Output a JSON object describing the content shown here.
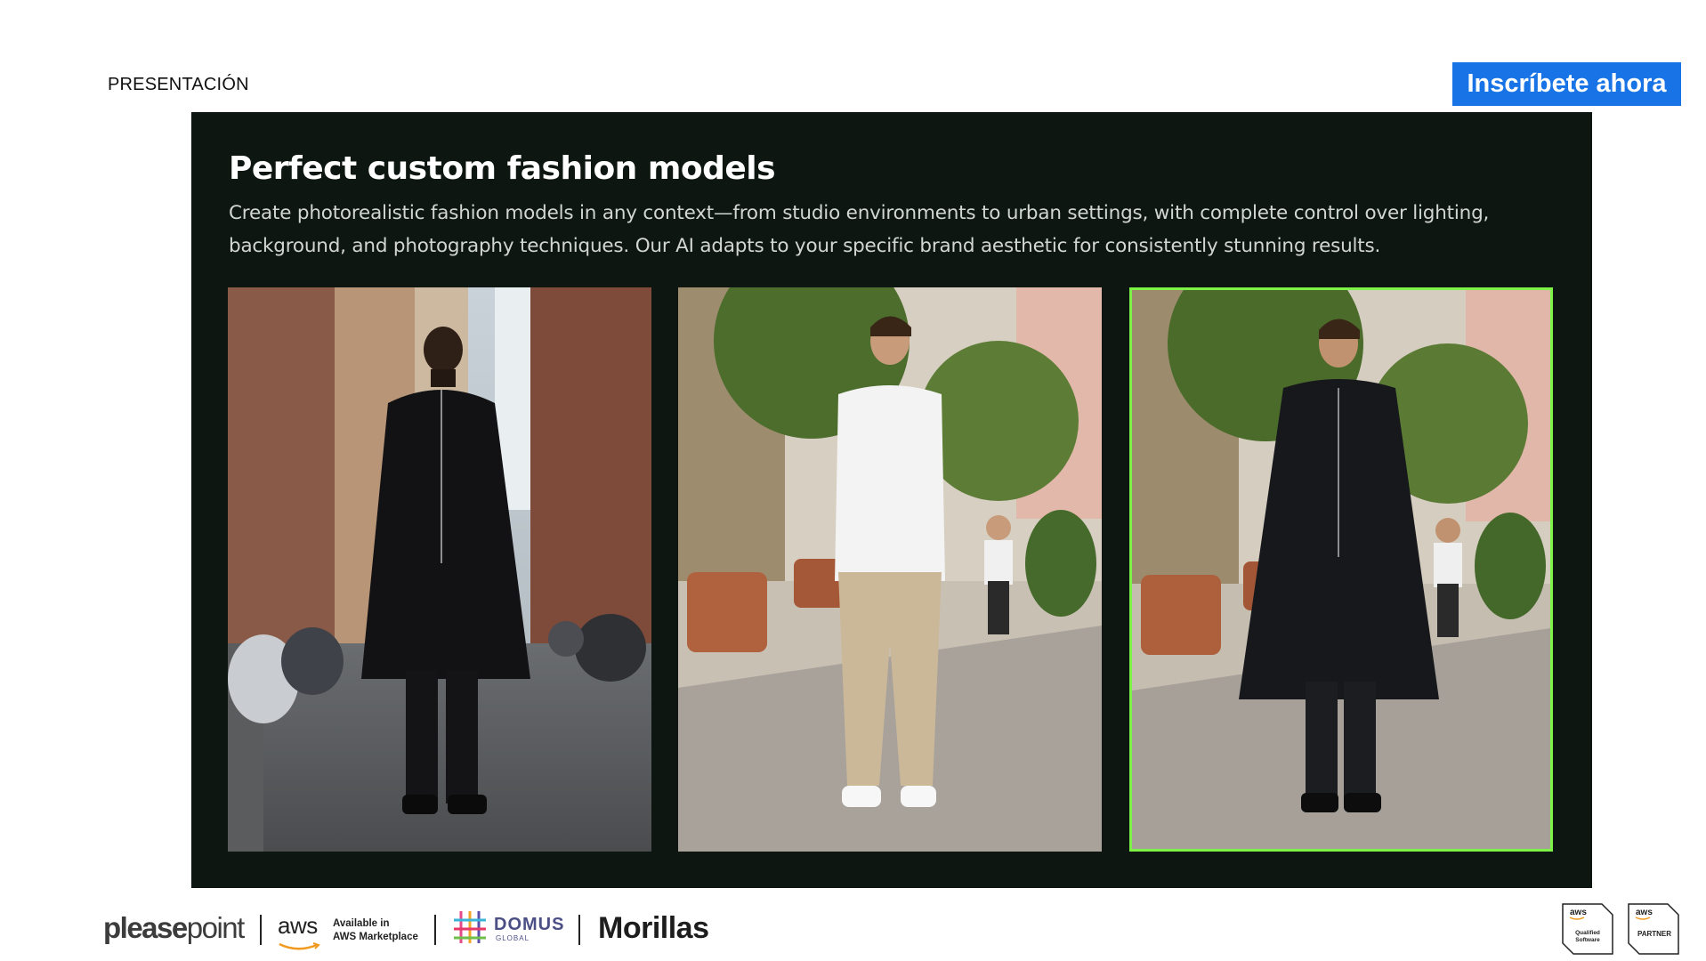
{
  "header": {
    "section_label": "PRESENTACIÓN",
    "cta_label": "Inscríbete ahora"
  },
  "slide": {
    "title": "Perfect custom fashion models",
    "description": "Create photorealistic fashion models in any context—from studio environments to urban settings, with complete control over lighting, background, and photography techniques. Our AI adapts to your specific brand aesthetic for consistently stunning results.",
    "selected_photo_index": 2
  },
  "footer": {
    "pleasepoint_bold": "please",
    "pleasepoint_light": "point",
    "aws_text": "aws",
    "aws_marketplace_line1": "Available in",
    "aws_marketplace_line2": "AWS Marketplace",
    "domus_word": "DOMUS",
    "domus_sub": "GLOBAL",
    "morillas": "Morillas",
    "badge_1_top": "aws",
    "badge_1_line1": "Qualified",
    "badge_1_line2": "Software",
    "badge_2_top": "aws",
    "badge_2_label": "PARTNER"
  },
  "colors": {
    "cta": "#1874e6",
    "panel_bg": "#0e1611",
    "selection_border": "#7df247"
  }
}
